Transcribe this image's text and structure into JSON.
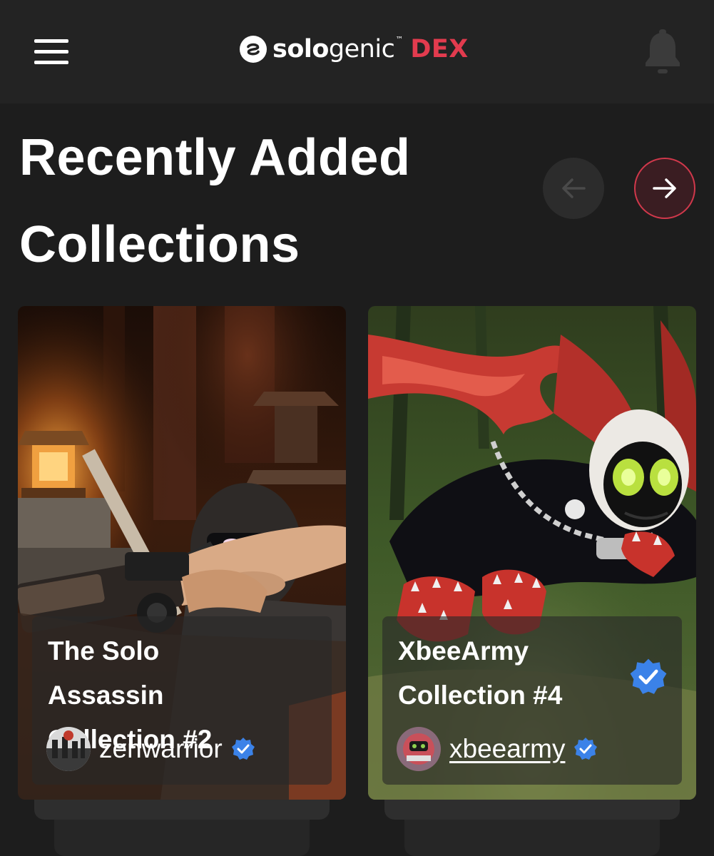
{
  "header": {
    "logo_solo": "solo",
    "logo_genic": "genic",
    "logo_tm": "™",
    "logo_dex": "DEX",
    "icons": [
      "menu-icon",
      "sologenic-logo-icon",
      "bell-icon"
    ]
  },
  "section": {
    "title_line1": "Recently Added",
    "title_line2": "Collections",
    "prev_icon": "arrow-left-icon",
    "next_icon": "arrow-right-icon"
  },
  "cards": [
    {
      "title_line1": "The Solo Assassin",
      "title_line2": "Collection #2",
      "creator": "zenwarrior",
      "creator_verified": true,
      "collection_verified": false
    },
    {
      "title_line1": "XbeeArmy",
      "title_line2": "Collection #4",
      "creator": "xbeearmy",
      "creator_verified": true,
      "collection_verified": true
    }
  ],
  "colors": {
    "background": "#1d1d1d",
    "header": "#232323",
    "accent": "#e23b4e",
    "verified": "#3b82e8"
  }
}
